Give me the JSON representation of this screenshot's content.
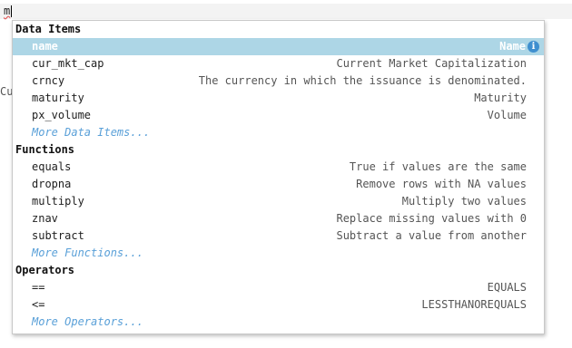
{
  "editor": {
    "typed_text": "m",
    "behind_text": "Cus"
  },
  "autocomplete": {
    "sections": [
      {
        "header": "Data Items",
        "items": [
          {
            "name": "name",
            "desc": "Name",
            "selected": true
          },
          {
            "name": "cur_mkt_cap",
            "desc": "Current Market Capitalization"
          },
          {
            "name": "crncy",
            "desc": "The currency in which the issuance is denominated."
          },
          {
            "name": "maturity",
            "desc": "Maturity"
          },
          {
            "name": "px_volume",
            "desc": "Volume"
          }
        ],
        "more": "More Data Items..."
      },
      {
        "header": "Functions",
        "items": [
          {
            "name": "equals",
            "desc": "True if values are the same"
          },
          {
            "name": "dropna",
            "desc": "Remove rows with NA values"
          },
          {
            "name": "multiply",
            "desc": "Multiply two values"
          },
          {
            "name": "znav",
            "desc": "Replace missing values with 0"
          },
          {
            "name": "subtract",
            "desc": "Subtract a value from another"
          }
        ],
        "more": "More Functions..."
      },
      {
        "header": "Operators",
        "items": [
          {
            "name": "==",
            "desc": "EQUALS"
          },
          {
            "name": "<=",
            "desc": "LESSTHANOREQUALS"
          }
        ],
        "more": "More Operators..."
      }
    ],
    "info_icon": "i"
  },
  "colors": {
    "selected_bg": "#add6e6",
    "more_link": "#5aa0d8",
    "info_icon": "#3f8fcf"
  }
}
